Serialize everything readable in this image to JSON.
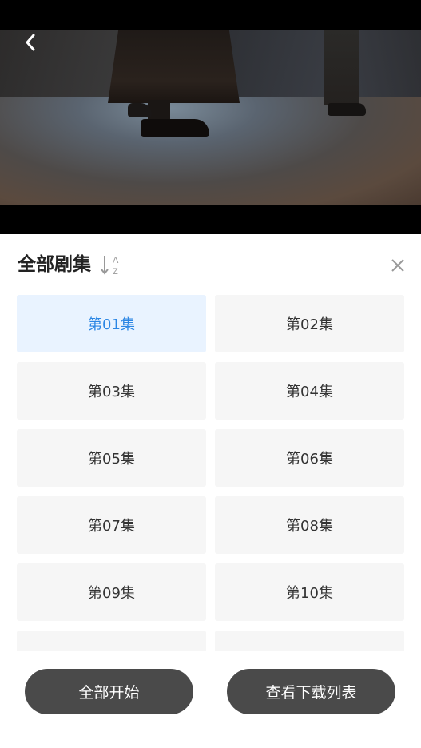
{
  "player": {
    "back_icon": "chevron-left-icon"
  },
  "panel": {
    "title": "全部剧集",
    "sort_icon": "sort-a-z-icon",
    "sort_letters": [
      "A",
      "Z"
    ],
    "close_icon": "close-icon",
    "active_color": "#2b86e4",
    "active_bg": "#e9f3ff",
    "episodes": [
      {
        "label": "第01集",
        "active": true
      },
      {
        "label": "第02集",
        "active": false
      },
      {
        "label": "第03集",
        "active": false
      },
      {
        "label": "第04集",
        "active": false
      },
      {
        "label": "第05集",
        "active": false
      },
      {
        "label": "第06集",
        "active": false
      },
      {
        "label": "第07集",
        "active": false
      },
      {
        "label": "第08集",
        "active": false
      },
      {
        "label": "第09集",
        "active": false
      },
      {
        "label": "第10集",
        "active": false
      },
      {
        "label": "",
        "active": false
      },
      {
        "label": "",
        "active": false
      }
    ]
  },
  "footer": {
    "start_all_label": "全部开始",
    "view_downloads_label": "查看下载列表",
    "button_color": "#4a4a4a"
  }
}
